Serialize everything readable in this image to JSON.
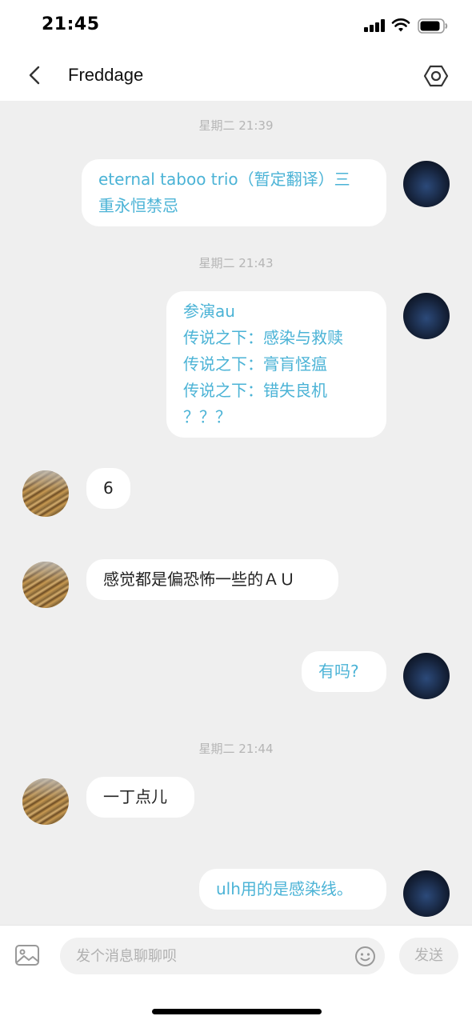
{
  "status_bar": {
    "time": "21:45"
  },
  "header": {
    "title": "Freddage"
  },
  "messages": [
    {
      "type": "timestamp",
      "text": "星期二 21:39"
    },
    {
      "type": "outgoing",
      "lines": [
        "eternal taboo trio（暂定翻译）三",
        "重永恒禁忌"
      ]
    },
    {
      "type": "timestamp",
      "text": "星期二 21:43"
    },
    {
      "type": "outgoing",
      "lines": [
        "参演au",
        "传说之下：感染与救赎",
        "传说之下：膏肓怪瘟",
        "传说之下：错失良机",
        "？？？"
      ]
    },
    {
      "type": "incoming",
      "lines": [
        "6"
      ]
    },
    {
      "type": "incoming",
      "lines": [
        "感觉都是偏恐怖一些的ＡＵ"
      ]
    },
    {
      "type": "outgoing",
      "lines": [
        "有吗?"
      ]
    },
    {
      "type": "timestamp",
      "text": "星期二 21:44"
    },
    {
      "type": "incoming",
      "lines": [
        "一丁点儿"
      ]
    },
    {
      "type": "outgoing",
      "lines": [
        "ulh用的是感染线。"
      ]
    }
  ],
  "input_bar": {
    "placeholder": "发个消息聊聊呗",
    "send_label": "发送"
  },
  "colors": {
    "outgoing_text": "#4bb3d6",
    "chat_background": "#efefef",
    "timestamp": "#b5b5b5"
  },
  "icons": [
    "back-icon",
    "settings-icon",
    "image-icon",
    "emoji-icon",
    "signal-icon",
    "wifi-icon",
    "battery-icon"
  ]
}
